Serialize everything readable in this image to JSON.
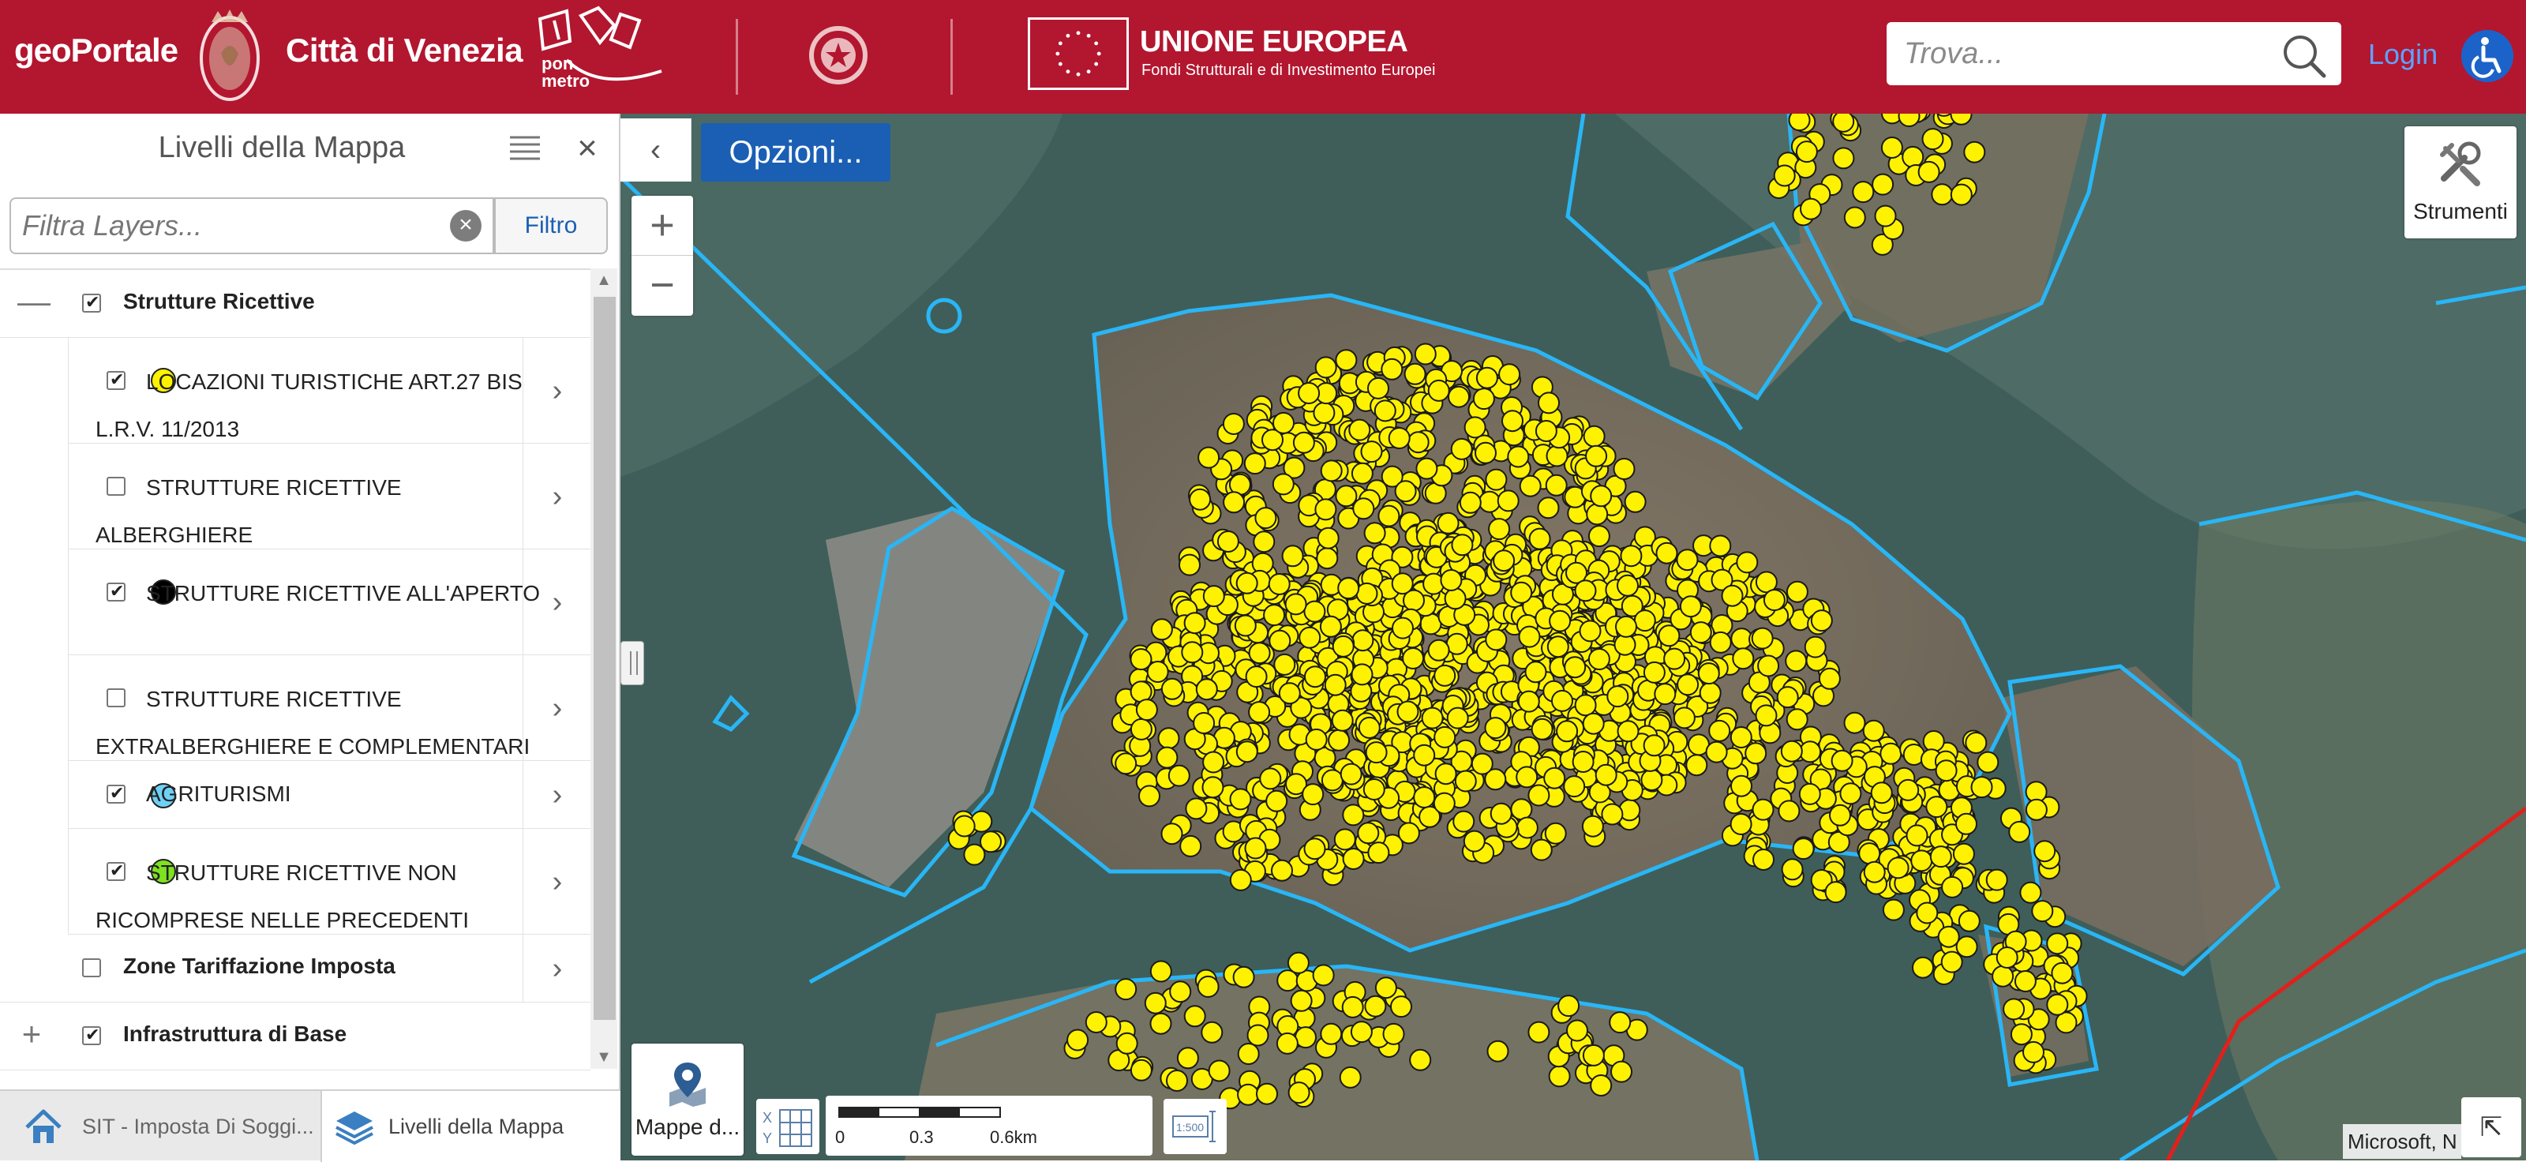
{
  "header": {
    "brand": "geoPortale",
    "city": "Città di Venezia",
    "ponmetro_logo_text": "pon metro",
    "eu_title": "UNIONE EUROPEA",
    "eu_subtitle": "Fondi Strutturali e di Investimento Europei",
    "search_placeholder": "Trova...",
    "login_label": "Login",
    "colors": {
      "background": "#b3162f",
      "login": "#5fa2ff",
      "accessibility": "#1c63c9"
    },
    "icons": [
      "crest-icon",
      "ponmetro-logo",
      "emblem-icon",
      "eu-flag-icon",
      "search-icon",
      "accessibility-icon"
    ]
  },
  "panel": {
    "title": "Livelli della Mappa",
    "filter_placeholder": "Filtra Layers...",
    "filter_button": "Filtro",
    "tree": [
      {
        "type": "group",
        "label": "Strutture Ricettive",
        "checked": true,
        "expanded": true,
        "toggle": "—",
        "children": [
          {
            "label": "LOCAZIONI TURISTICHE ART.27 BIS L.R.V. 11/2013",
            "checked": true,
            "symbol_color": "#fff200"
          },
          {
            "label": "STRUTTURE RICETTIVE ALBERGHIERE",
            "checked": false,
            "symbol_color": null
          },
          {
            "label": "STRUTTURE RICETTIVE ALL'APERTO",
            "checked": true,
            "symbol_color": "#000000"
          },
          {
            "label": "STRUTTURE RICETTIVE EXTRALBERGHIERE E COMPLEMENTARI",
            "checked": false,
            "symbol_color": null
          },
          {
            "label": "AGRITURISMI",
            "checked": true,
            "symbol_color": "#6fd0f6"
          },
          {
            "label": "STRUTTURE RICETTIVE NON RICOMPRESE NELLE PRECEDENTI",
            "checked": true,
            "symbol_color": "#7ee21f"
          }
        ]
      },
      {
        "type": "layer",
        "label": "Zone Tariffazione Imposta",
        "checked": false
      },
      {
        "type": "group",
        "label": "Infrastruttura di Base",
        "checked": true,
        "expanded": false,
        "toggle": "+"
      }
    ],
    "tabs": [
      {
        "label": "SIT - Imposta Di Soggi...",
        "icon": "home-icon",
        "active": false
      },
      {
        "label": "Livelli della Mappa",
        "icon": "layers-icon",
        "active": true
      }
    ]
  },
  "map": {
    "options_button": "Opzioni...",
    "zoom_in": "+",
    "zoom_out": "−",
    "tools_label": "Strumenti",
    "basemap_label": "Mappe d...",
    "scale_labels": [
      "0",
      "0.3",
      "0.6km"
    ],
    "attribution": "Microsoft, N",
    "colors": {
      "boundary": "#29b6f6",
      "point": "#fff200",
      "point_stroke": "#1a1a1a",
      "line": "#e0211b",
      "water": "#3f5e5a"
    }
  }
}
